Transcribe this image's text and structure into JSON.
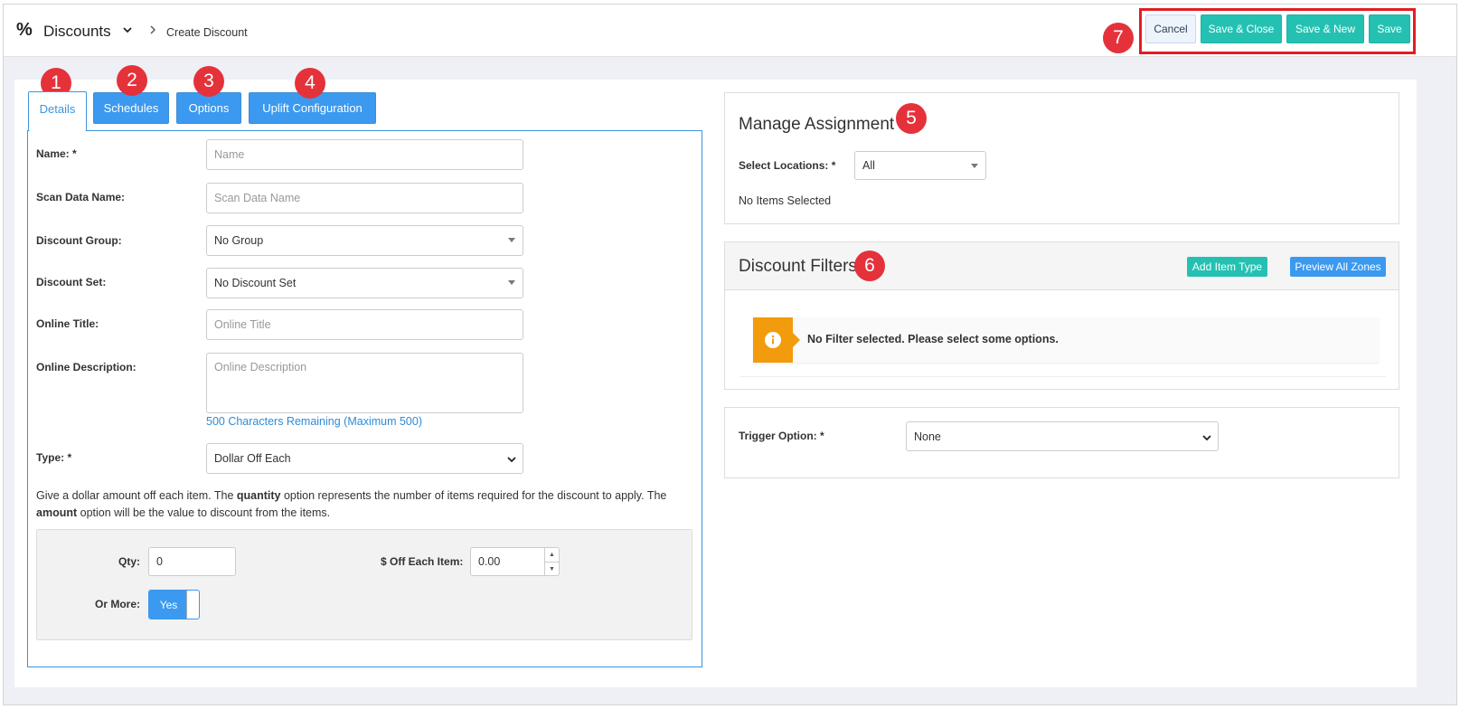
{
  "header": {
    "module_icon": "percent-icon",
    "module_title": "Discounts",
    "breadcrumb_current": "Create Discount"
  },
  "actions": {
    "cancel": "Cancel",
    "save_close": "Save & Close",
    "save_new": "Save & New",
    "save": "Save"
  },
  "badges": [
    "1",
    "2",
    "3",
    "4",
    "5",
    "6",
    "7"
  ],
  "tabs": [
    {
      "label": "Details",
      "active": true
    },
    {
      "label": "Schedules",
      "active": false
    },
    {
      "label": "Options",
      "active": false
    },
    {
      "label": "Uplift Configuration",
      "active": false
    }
  ],
  "details": {
    "name_label": "Name: *",
    "name_placeholder": "Name",
    "scan_label": "Scan Data Name:",
    "scan_placeholder": "Scan Data Name",
    "group_label": "Discount Group:",
    "group_value": "No Group",
    "set_label": "Discount Set:",
    "set_value": "No Discount Set",
    "online_title_label": "Online Title:",
    "online_title_placeholder": "Online Title",
    "online_desc_label": "Online Description:",
    "online_desc_placeholder": "Online Description",
    "remaining": "500 Characters Remaining (Maximum 500)",
    "type_label": "Type: *",
    "type_value": "Dollar Off Each",
    "help_1": "Give a dollar amount off each item. The ",
    "help_q": "quantity",
    "help_2": " option represents the number of items required for the discount to apply. The ",
    "help_a": "amount",
    "help_3": " option will be the value to discount from the items.",
    "qty_label": "Qty:",
    "qty_value": "0",
    "off_label": "$ Off Each Item:",
    "off_value": "0.00",
    "or_more_label": "Or More:",
    "or_more_value": "Yes"
  },
  "assignment": {
    "title": "Manage Assignment",
    "locations_label": "Select Locations: *",
    "locations_value": "All",
    "none_selected": "No Items Selected"
  },
  "filters": {
    "title": "Discount Filters",
    "add_item_type": "Add Item Type",
    "preview_zones": "Preview All Zones",
    "alert": "No Filter selected. Please select some options."
  },
  "trigger": {
    "label": "Trigger Option: *",
    "value": "None"
  },
  "colors": {
    "accent_blue": "#3b99f0",
    "teal": "#24c1b2",
    "badge_red": "#e5323a",
    "highlight_red": "#e11d25",
    "warning_orange": "#f29b0c"
  }
}
